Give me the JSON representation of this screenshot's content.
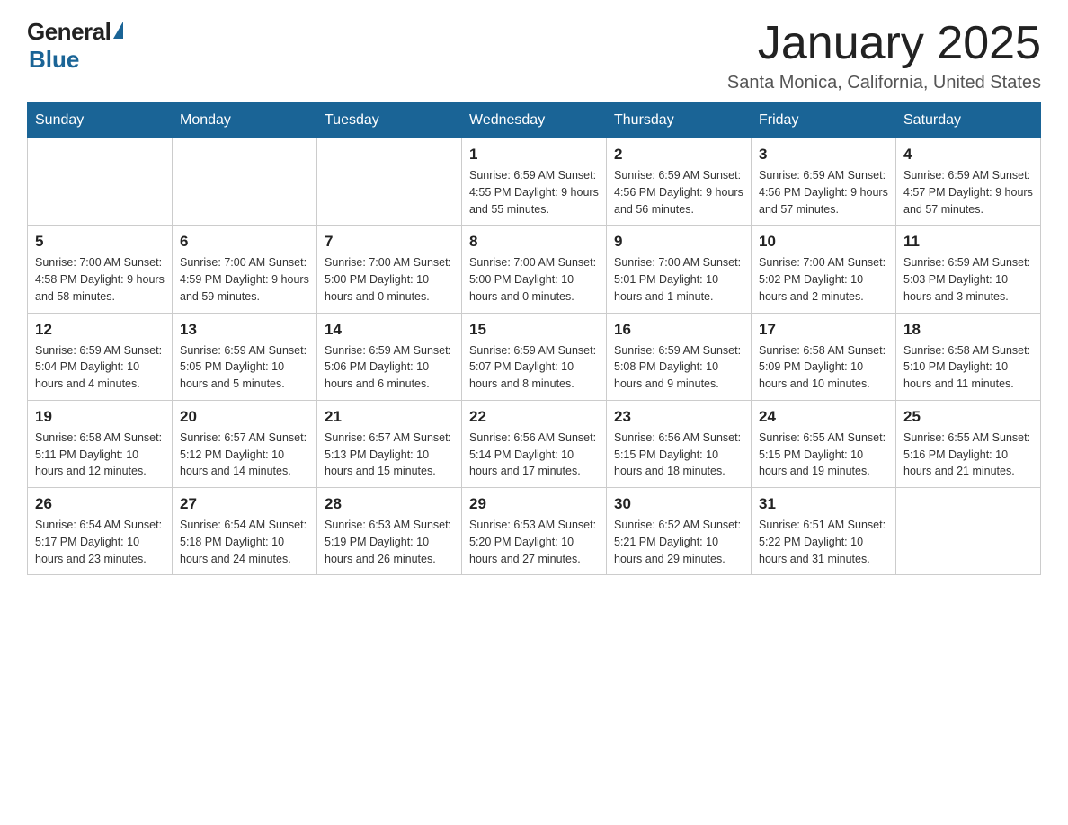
{
  "header": {
    "logo_general": "General",
    "logo_blue": "Blue",
    "title": "January 2025",
    "subtitle": "Santa Monica, California, United States"
  },
  "weekdays": [
    "Sunday",
    "Monday",
    "Tuesday",
    "Wednesday",
    "Thursday",
    "Friday",
    "Saturday"
  ],
  "weeks": [
    [
      {
        "day": "",
        "info": ""
      },
      {
        "day": "",
        "info": ""
      },
      {
        "day": "",
        "info": ""
      },
      {
        "day": "1",
        "info": "Sunrise: 6:59 AM\nSunset: 4:55 PM\nDaylight: 9 hours\nand 55 minutes."
      },
      {
        "day": "2",
        "info": "Sunrise: 6:59 AM\nSunset: 4:56 PM\nDaylight: 9 hours\nand 56 minutes."
      },
      {
        "day": "3",
        "info": "Sunrise: 6:59 AM\nSunset: 4:56 PM\nDaylight: 9 hours\nand 57 minutes."
      },
      {
        "day": "4",
        "info": "Sunrise: 6:59 AM\nSunset: 4:57 PM\nDaylight: 9 hours\nand 57 minutes."
      }
    ],
    [
      {
        "day": "5",
        "info": "Sunrise: 7:00 AM\nSunset: 4:58 PM\nDaylight: 9 hours\nand 58 minutes."
      },
      {
        "day": "6",
        "info": "Sunrise: 7:00 AM\nSunset: 4:59 PM\nDaylight: 9 hours\nand 59 minutes."
      },
      {
        "day": "7",
        "info": "Sunrise: 7:00 AM\nSunset: 5:00 PM\nDaylight: 10 hours\nand 0 minutes."
      },
      {
        "day": "8",
        "info": "Sunrise: 7:00 AM\nSunset: 5:00 PM\nDaylight: 10 hours\nand 0 minutes."
      },
      {
        "day": "9",
        "info": "Sunrise: 7:00 AM\nSunset: 5:01 PM\nDaylight: 10 hours\nand 1 minute."
      },
      {
        "day": "10",
        "info": "Sunrise: 7:00 AM\nSunset: 5:02 PM\nDaylight: 10 hours\nand 2 minutes."
      },
      {
        "day": "11",
        "info": "Sunrise: 6:59 AM\nSunset: 5:03 PM\nDaylight: 10 hours\nand 3 minutes."
      }
    ],
    [
      {
        "day": "12",
        "info": "Sunrise: 6:59 AM\nSunset: 5:04 PM\nDaylight: 10 hours\nand 4 minutes."
      },
      {
        "day": "13",
        "info": "Sunrise: 6:59 AM\nSunset: 5:05 PM\nDaylight: 10 hours\nand 5 minutes."
      },
      {
        "day": "14",
        "info": "Sunrise: 6:59 AM\nSunset: 5:06 PM\nDaylight: 10 hours\nand 6 minutes."
      },
      {
        "day": "15",
        "info": "Sunrise: 6:59 AM\nSunset: 5:07 PM\nDaylight: 10 hours\nand 8 minutes."
      },
      {
        "day": "16",
        "info": "Sunrise: 6:59 AM\nSunset: 5:08 PM\nDaylight: 10 hours\nand 9 minutes."
      },
      {
        "day": "17",
        "info": "Sunrise: 6:58 AM\nSunset: 5:09 PM\nDaylight: 10 hours\nand 10 minutes."
      },
      {
        "day": "18",
        "info": "Sunrise: 6:58 AM\nSunset: 5:10 PM\nDaylight: 10 hours\nand 11 minutes."
      }
    ],
    [
      {
        "day": "19",
        "info": "Sunrise: 6:58 AM\nSunset: 5:11 PM\nDaylight: 10 hours\nand 12 minutes."
      },
      {
        "day": "20",
        "info": "Sunrise: 6:57 AM\nSunset: 5:12 PM\nDaylight: 10 hours\nand 14 minutes."
      },
      {
        "day": "21",
        "info": "Sunrise: 6:57 AM\nSunset: 5:13 PM\nDaylight: 10 hours\nand 15 minutes."
      },
      {
        "day": "22",
        "info": "Sunrise: 6:56 AM\nSunset: 5:14 PM\nDaylight: 10 hours\nand 17 minutes."
      },
      {
        "day": "23",
        "info": "Sunrise: 6:56 AM\nSunset: 5:15 PM\nDaylight: 10 hours\nand 18 minutes."
      },
      {
        "day": "24",
        "info": "Sunrise: 6:55 AM\nSunset: 5:15 PM\nDaylight: 10 hours\nand 19 minutes."
      },
      {
        "day": "25",
        "info": "Sunrise: 6:55 AM\nSunset: 5:16 PM\nDaylight: 10 hours\nand 21 minutes."
      }
    ],
    [
      {
        "day": "26",
        "info": "Sunrise: 6:54 AM\nSunset: 5:17 PM\nDaylight: 10 hours\nand 23 minutes."
      },
      {
        "day": "27",
        "info": "Sunrise: 6:54 AM\nSunset: 5:18 PM\nDaylight: 10 hours\nand 24 minutes."
      },
      {
        "day": "28",
        "info": "Sunrise: 6:53 AM\nSunset: 5:19 PM\nDaylight: 10 hours\nand 26 minutes."
      },
      {
        "day": "29",
        "info": "Sunrise: 6:53 AM\nSunset: 5:20 PM\nDaylight: 10 hours\nand 27 minutes."
      },
      {
        "day": "30",
        "info": "Sunrise: 6:52 AM\nSunset: 5:21 PM\nDaylight: 10 hours\nand 29 minutes."
      },
      {
        "day": "31",
        "info": "Sunrise: 6:51 AM\nSunset: 5:22 PM\nDaylight: 10 hours\nand 31 minutes."
      },
      {
        "day": "",
        "info": ""
      }
    ]
  ]
}
